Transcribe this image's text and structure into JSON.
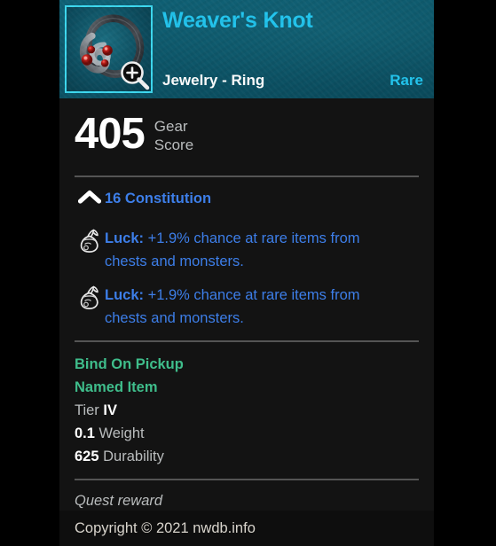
{
  "item": {
    "name": "Weaver's Knot",
    "type": "Jewelry - Ring",
    "rarity": "Rare",
    "thumbnail_icon": "ring-item-icon",
    "zoom_badge_icon": "magnifier-zoom-in-icon"
  },
  "gear_score": {
    "value": "405",
    "label_line1": "Gear",
    "label_line2": "Score"
  },
  "attributes": [
    {
      "icon": "chevron-up-icon",
      "text": "16 Constitution"
    }
  ],
  "perks": [
    {
      "icon": "loot-bag-icon",
      "name": "Luck:",
      "description": " +1.9% chance at rare items from chests and monsters."
    },
    {
      "icon": "loot-bag-icon",
      "name": "Luck:",
      "description": " +1.9% chance at rare items from chests and monsters."
    }
  ],
  "meta": {
    "bind": "Bind On Pickup",
    "named": "Named Item",
    "tier_label": "Tier",
    "tier_value": "IV",
    "weight_value": "0.1",
    "weight_label": "Weight",
    "durability_value": "625",
    "durability_label": "Durability"
  },
  "flavor_text": "Quest reward",
  "footer": {
    "copyright": "Copyright © 2021 nwdb.info"
  },
  "colors": {
    "rarity_accent": "#21c4ed",
    "attribute_blue": "#3d7ee8",
    "meta_green": "#3fbd8b",
    "header_teal": "#0c5568",
    "panel_bg": "#131313"
  }
}
